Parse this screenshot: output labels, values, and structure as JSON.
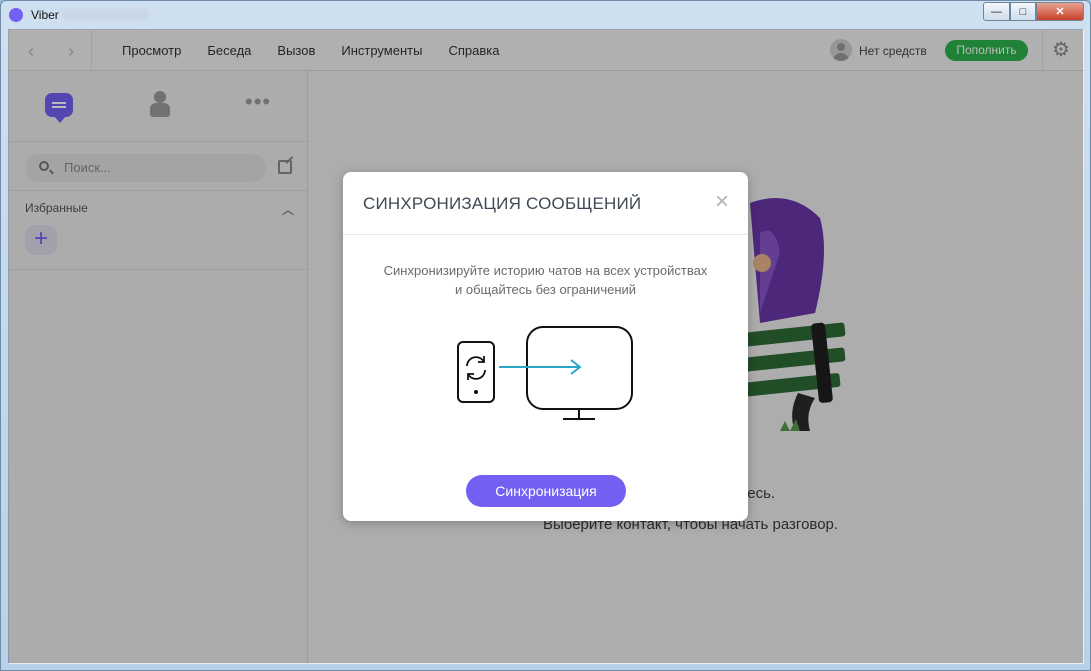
{
  "window": {
    "title": "Viber",
    "controls": {
      "minimize": "—",
      "maximize": "□",
      "close": "✕"
    }
  },
  "toolbar": {
    "back_icon": "chevron-left-icon",
    "forward_icon": "chevron-right-icon",
    "menu": [
      "Просмотр",
      "Беседа",
      "Вызов",
      "Инструменты",
      "Справка"
    ],
    "account_status": "Нет средств",
    "topup_label": "Пополнить",
    "settings_icon": "gear-icon"
  },
  "sidebar": {
    "tabs": [
      {
        "icon": "chats-icon",
        "active": true
      },
      {
        "icon": "contacts-icon",
        "active": false
      },
      {
        "icon": "more-icon",
        "active": false
      }
    ],
    "search": {
      "placeholder": "Поиск...",
      "value": ""
    },
    "favorites": {
      "label": "Избранные",
      "add_label": "+"
    }
  },
  "main": {
    "empty_line1": "здесь.",
    "empty_line2": "Выберите контакт, чтобы начать разговор."
  },
  "dialog": {
    "title": "СИНХРОНИЗАЦИЯ СООБЩЕНИЙ",
    "close": "×",
    "description": "Синхронизируйте историю чатов на всех устройствах и общайтесь без ограничений",
    "button_label": "Синхронизация"
  },
  "colors": {
    "accent": "#7360f2",
    "topup": "#2db24a",
    "sync_arrow": "#2aa7c9"
  }
}
